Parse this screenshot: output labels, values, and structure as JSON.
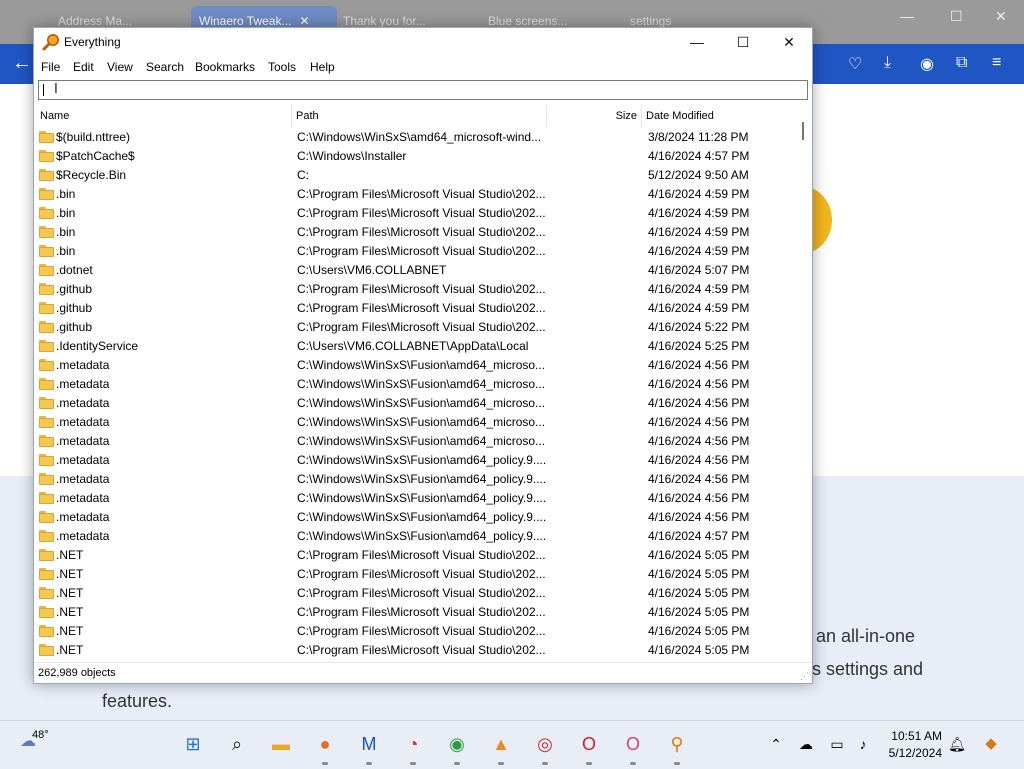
{
  "browser": {
    "tabs": [
      {
        "label": "Address Ma...",
        "active": false
      },
      {
        "label": "Winaero Tweak...",
        "active": true
      },
      {
        "label": "Thank you for...",
        "active": false
      },
      {
        "label": "Blue screens...",
        "active": false
      },
      {
        "label": "settings",
        "active": false
      }
    ],
    "page_text": {
      "line1": "an  all-in-one",
      "line2": "s settings and",
      "line3": "features."
    }
  },
  "window": {
    "title": "Everything",
    "minimize": "—",
    "maximize": "☐",
    "close": "✕"
  },
  "menu": [
    "File",
    "Edit",
    "View",
    "Search",
    "Bookmarks",
    "Tools",
    "Help"
  ],
  "search": {
    "value": "",
    "placeholder": ""
  },
  "columns": {
    "name": "Name",
    "path": "Path",
    "size": "Size",
    "date": "Date Modified"
  },
  "rows": [
    {
      "name": "$(build.nttree)",
      "path": "C:\\Windows\\WinSxS\\amd64_microsoft-wind...",
      "size": "",
      "date": "3/8/2024 11:28 PM"
    },
    {
      "name": "$PatchCache$",
      "path": "C:\\Windows\\Installer",
      "size": "",
      "date": "4/16/2024 4:57 PM"
    },
    {
      "name": "$Recycle.Bin",
      "path": "C:",
      "size": "",
      "date": "5/12/2024 9:50 AM"
    },
    {
      "name": ".bin",
      "path": "C:\\Program Files\\Microsoft Visual Studio\\202...",
      "size": "",
      "date": "4/16/2024 4:59 PM"
    },
    {
      "name": ".bin",
      "path": "C:\\Program Files\\Microsoft Visual Studio\\202...",
      "size": "",
      "date": "4/16/2024 4:59 PM"
    },
    {
      "name": ".bin",
      "path": "C:\\Program Files\\Microsoft Visual Studio\\202...",
      "size": "",
      "date": "4/16/2024 4:59 PM"
    },
    {
      "name": ".bin",
      "path": "C:\\Program Files\\Microsoft Visual Studio\\202...",
      "size": "",
      "date": "4/16/2024 4:59 PM"
    },
    {
      "name": ".dotnet",
      "path": "C:\\Users\\VM6.COLLABNET",
      "size": "",
      "date": "4/16/2024 5:07 PM"
    },
    {
      "name": ".github",
      "path": "C:\\Program Files\\Microsoft Visual Studio\\202...",
      "size": "",
      "date": "4/16/2024 4:59 PM"
    },
    {
      "name": ".github",
      "path": "C:\\Program Files\\Microsoft Visual Studio\\202...",
      "size": "",
      "date": "4/16/2024 4:59 PM"
    },
    {
      "name": ".github",
      "path": "C:\\Program Files\\Microsoft Visual Studio\\202...",
      "size": "",
      "date": "4/16/2024 5:22 PM"
    },
    {
      "name": ".IdentityService",
      "path": "C:\\Users\\VM6.COLLABNET\\AppData\\Local",
      "size": "",
      "date": "4/16/2024 5:25 PM"
    },
    {
      "name": ".metadata",
      "path": "C:\\Windows\\WinSxS\\Fusion\\amd64_microso...",
      "size": "",
      "date": "4/16/2024 4:56 PM"
    },
    {
      "name": ".metadata",
      "path": "C:\\Windows\\WinSxS\\Fusion\\amd64_microso...",
      "size": "",
      "date": "4/16/2024 4:56 PM"
    },
    {
      "name": ".metadata",
      "path": "C:\\Windows\\WinSxS\\Fusion\\amd64_microso...",
      "size": "",
      "date": "4/16/2024 4:56 PM"
    },
    {
      "name": ".metadata",
      "path": "C:\\Windows\\WinSxS\\Fusion\\amd64_microso...",
      "size": "",
      "date": "4/16/2024 4:56 PM"
    },
    {
      "name": ".metadata",
      "path": "C:\\Windows\\WinSxS\\Fusion\\amd64_microso...",
      "size": "",
      "date": "4/16/2024 4:56 PM"
    },
    {
      "name": ".metadata",
      "path": "C:\\Windows\\WinSxS\\Fusion\\amd64_policy.9....",
      "size": "",
      "date": "4/16/2024 4:56 PM"
    },
    {
      "name": ".metadata",
      "path": "C:\\Windows\\WinSxS\\Fusion\\amd64_policy.9....",
      "size": "",
      "date": "4/16/2024 4:56 PM"
    },
    {
      "name": ".metadata",
      "path": "C:\\Windows\\WinSxS\\Fusion\\amd64_policy.9....",
      "size": "",
      "date": "4/16/2024 4:56 PM"
    },
    {
      "name": ".metadata",
      "path": "C:\\Windows\\WinSxS\\Fusion\\amd64_policy.9....",
      "size": "",
      "date": "4/16/2024 4:56 PM"
    },
    {
      "name": ".metadata",
      "path": "C:\\Windows\\WinSxS\\Fusion\\amd64_policy.9....",
      "size": "",
      "date": "4/16/2024 4:57 PM"
    },
    {
      "name": ".NET",
      "path": "C:\\Program Files\\Microsoft Visual Studio\\202...",
      "size": "",
      "date": "4/16/2024 5:05 PM"
    },
    {
      "name": ".NET",
      "path": "C:\\Program Files\\Microsoft Visual Studio\\202...",
      "size": "",
      "date": "4/16/2024 5:05 PM"
    },
    {
      "name": ".NET",
      "path": "C:\\Program Files\\Microsoft Visual Studio\\202...",
      "size": "",
      "date": "4/16/2024 5:05 PM"
    },
    {
      "name": ".NET",
      "path": "C:\\Program Files\\Microsoft Visual Studio\\202...",
      "size": "",
      "date": "4/16/2024 5:05 PM"
    },
    {
      "name": ".NET",
      "path": "C:\\Program Files\\Microsoft Visual Studio\\202...",
      "size": "",
      "date": "4/16/2024 5:05 PM"
    },
    {
      "name": ".NET",
      "path": "C:\\Program Files\\Microsoft Visual Studio\\202...",
      "size": "",
      "date": "4/16/2024 5:05 PM"
    }
  ],
  "status": {
    "objects": "262,989 objects"
  },
  "taskbar": {
    "weather": "48°",
    "apps": [
      {
        "name": "windows-start-icon",
        "glyph": "⊞",
        "color": "#1f6fd6",
        "running": false
      },
      {
        "name": "search-icon",
        "glyph": "⌕",
        "color": "#222222",
        "running": false
      },
      {
        "name": "file-explorer-icon",
        "glyph": "▬",
        "color": "#e8a92a",
        "running": false
      },
      {
        "name": "firefox-icon",
        "glyph": "●",
        "color": "#e66b1f",
        "running": true
      },
      {
        "name": "malwarebytes-icon",
        "glyph": "M",
        "color": "#1a4fd1",
        "running": true
      },
      {
        "name": "ccleaner-icon",
        "glyph": "◔",
        "color": "#d6312b",
        "running": true
      },
      {
        "name": "chrome-icon",
        "glyph": "◉",
        "color": "#2e9a46",
        "running": true
      },
      {
        "name": "vlc-icon",
        "glyph": "▲",
        "color": "#f08a1c",
        "running": true
      },
      {
        "name": "app-icon",
        "glyph": "◎",
        "color": "#c9302c",
        "running": true
      },
      {
        "name": "opera-icon",
        "glyph": "O",
        "color": "#e0162b",
        "running": true
      },
      {
        "name": "opera-gx-icon",
        "glyph": "O",
        "color": "#d94468",
        "running": true
      },
      {
        "name": "everything-icon",
        "glyph": "⚲",
        "color": "#e07b12",
        "running": true
      }
    ],
    "time": "10:51 AM",
    "date": "5/12/2024"
  }
}
